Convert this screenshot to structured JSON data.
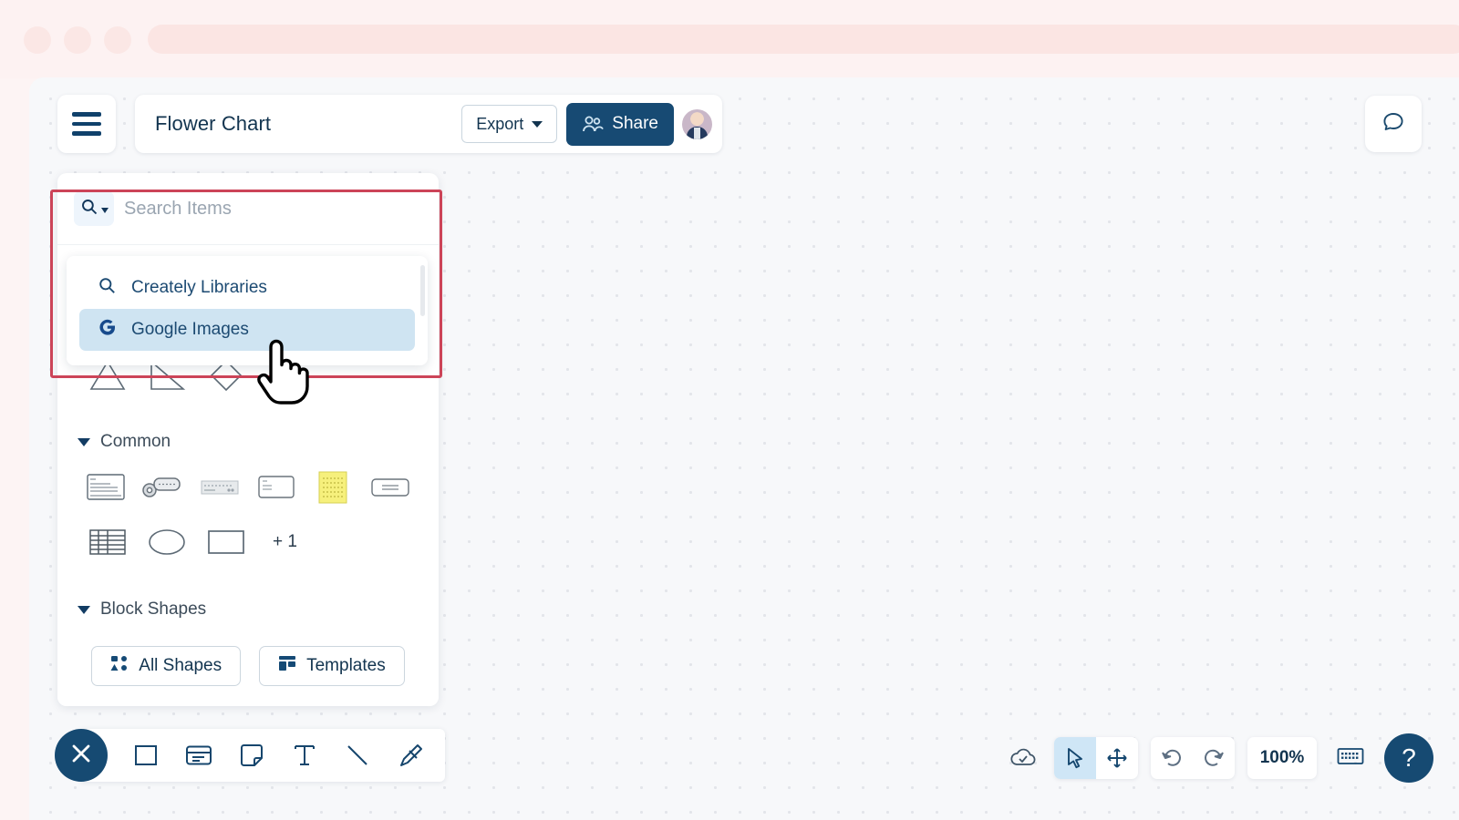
{
  "browser": {
    "dots": [
      "traffic-light-1",
      "traffic-light-2",
      "traffic-light-3"
    ]
  },
  "topbar": {
    "menu_icon": "hamburger-icon",
    "doc_title": "Flower Chart",
    "export_label": "Export",
    "export_caret": "chevron-down-icon",
    "share_label": "Share",
    "share_icon": "people-icon",
    "avatar_alt": "user-avatar"
  },
  "chat": {
    "icon": "chat-bubble-icon"
  },
  "search": {
    "placeholder": "Search Items",
    "value": "",
    "type_icon": "search-icon",
    "type_caret": "caret-down-icon"
  },
  "dropdown": {
    "items": [
      {
        "label": "Creately Libraries",
        "icon": "search-icon",
        "selected": false
      },
      {
        "label": "Google Images",
        "icon": "google-g-icon",
        "selected": true
      }
    ]
  },
  "panel": {
    "shape_row_top": [
      {
        "name": "triangle-shape"
      },
      {
        "name": "right-triangle-shape"
      },
      {
        "name": "diamond-shape"
      }
    ],
    "sections": [
      {
        "label": "Common",
        "caret": "caret-down-icon",
        "rows": [
          [
            {
              "name": "document-card-shape"
            },
            {
              "name": "key-tag-shape"
            },
            {
              "name": "dashed-strip-shape"
            },
            {
              "name": "note-card-shape"
            },
            {
              "name": "yellow-sticky-shape"
            },
            {
              "name": "rounded-label-shape"
            }
          ],
          [
            {
              "name": "table-shape"
            },
            {
              "name": "ellipse-shape"
            },
            {
              "name": "rectangle-shape"
            },
            {
              "name": "more-shapes-count",
              "label": "+ 1"
            }
          ]
        ]
      },
      {
        "label": "Block Shapes",
        "caret": "caret-down-icon",
        "rows": []
      }
    ],
    "footer": {
      "all_shapes_label": "All Shapes",
      "all_shapes_icon": "shapes-grid-icon",
      "templates_label": "Templates",
      "templates_icon": "templates-layout-icon"
    }
  },
  "bottom_toolbar": {
    "close_icon": "close-x-icon",
    "tools": [
      {
        "name": "rectangle-tool-icon"
      },
      {
        "name": "card-tool-icon"
      },
      {
        "name": "sticky-note-tool-icon"
      },
      {
        "name": "text-tool-icon"
      },
      {
        "name": "line-tool-icon"
      },
      {
        "name": "pen-tool-icon"
      }
    ]
  },
  "bottom_right": {
    "cloud_icon": "cloud-saved-icon",
    "select_icon": "cursor-select-icon",
    "pan_icon": "pan-move-icon",
    "undo_icon": "undo-icon",
    "redo_icon": "redo-icon",
    "zoom_level": "100%",
    "keyboard_icon": "keyboard-icon",
    "help_label": "?"
  },
  "cursor": {
    "icon": "pointing-hand-cursor"
  },
  "colors": {
    "highlight": "#cc4458",
    "brand_dark": "#164a72",
    "selected_item": "#cfe4f2",
    "chrome_tint": "#fdf2f2",
    "canvas_bg": "#f7f8fa"
  }
}
